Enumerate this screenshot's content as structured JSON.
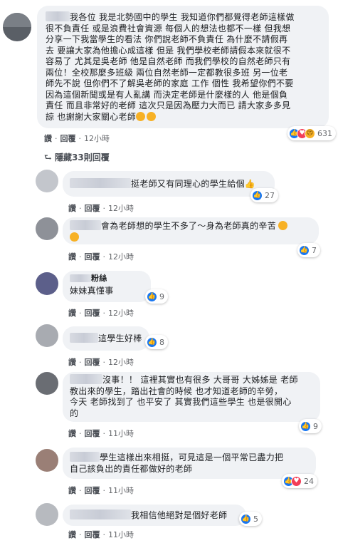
{
  "top_comment": {
    "text_lines": [
      "我各位 我是北勢國中的學生 我知道你們都覺得老師這樣做",
      "很不負責任 或是浪費社會資源 每個人的想法也都不一樣 但我想",
      "分享一下我當學生的看法 你們說老師不負責任 為什麼不請假再",
      "去 要讓大家為他擔心成這樣 但是 我們學校老師請假本來就很不",
      "容易了 尤其是吳老師 他是自然老師 而我們學校的自然老師只有",
      "兩位！全校那麼多班級 兩位自然老師一定都教很多班 另一位老",
      "師先不說 但你們不了解吳老師的家庭 工作 個性 我希望你們不要",
      "因為這個新聞或是有人亂講 而決定老師是什麼樣的人 他是個負",
      "責任 而且非常好的老師 這次只是因為壓力大而已 請大家多多見",
      "諒 也謝謝大家關心老師"
    ],
    "like_label": "讚",
    "reply_label": "回覆",
    "time": "12小時",
    "reaction_count": "631"
  },
  "hidden_replies_label": "隱藏33則回覆",
  "replies": [
    {
      "text_lines": [
        "挺老師又有同理心的學生給個"
      ],
      "like_label": "讚",
      "reply_label": "回覆",
      "time": "12小時",
      "reaction_count": "27"
    },
    {
      "text_lines": [
        "會為老師想的學生不多了～身為老師真的辛苦"
      ],
      "like_label": "讚",
      "reply_label": "回覆",
      "time": "12小時",
      "reaction_count": "7"
    },
    {
      "name_suffix": "粉絲",
      "text_lines": [
        "妹妹真懂事"
      ],
      "like_label": "讚",
      "reply_label": "回覆",
      "time": "12小時",
      "reaction_count": "9"
    },
    {
      "text_lines": [
        "這學生好棒"
      ],
      "like_label": "讚",
      "reply_label": "回覆",
      "time": "12小時",
      "reaction_count": "8"
    },
    {
      "text_lines": [
        "沒事！！ 這裡其實也有很多 大哥哥 大姊姊是 老師",
        "教出來的學生，踏出社會的時候 也才知道老師的辛勞，",
        "今天 老師找到了 也平安了 其實我們這些學生 也是很開心",
        "的"
      ],
      "like_label": "讚",
      "reply_label": "回覆",
      "time": "11小時",
      "reaction_count": "9"
    },
    {
      "text_lines": [
        "學生這樣出來相挺，可見這是一個平常已盡力把",
        "自己該負出的責任都做好的老師"
      ],
      "like_label": "讚",
      "reply_label": "回覆",
      "time": "11小時",
      "reaction_count": "24"
    },
    {
      "text_lines": [
        "我相信他絕對是個好老師"
      ],
      "like_label": "讚",
      "reply_label": "回覆",
      "time": "11小時",
      "reaction_count": "5"
    }
  ],
  "colors": {
    "like": "#1877f2",
    "love": "#f33e58",
    "sad": "#f7b125",
    "bubble": "#f0f2f5",
    "meta": "#65676b"
  }
}
